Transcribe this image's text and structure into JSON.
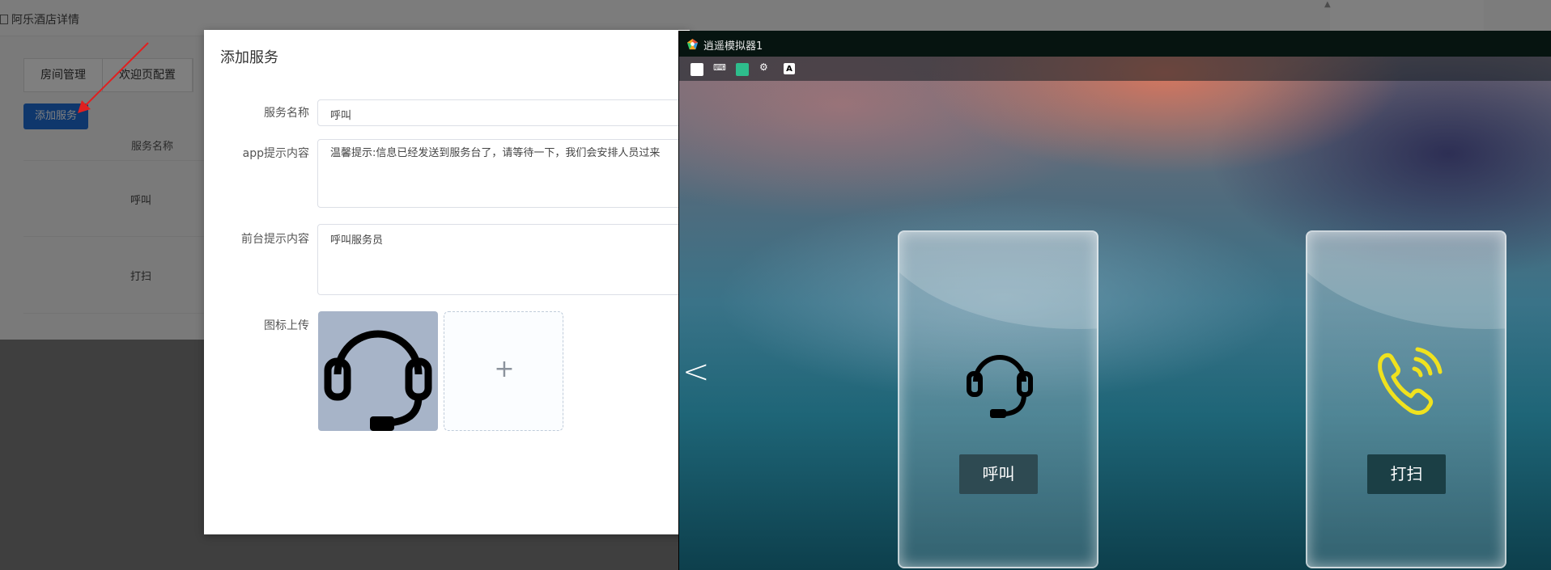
{
  "background_page": {
    "title": "阿乐酒店详情",
    "tabs": [
      "房间管理",
      "欢迎页配置"
    ],
    "add_button": "添加服务",
    "table": {
      "column_header": "服务名称",
      "rows": [
        "呼叫",
        "打扫"
      ]
    }
  },
  "modal": {
    "title": "添加服务",
    "fields": {
      "service_name": {
        "label": "服务名称",
        "value": "呼叫"
      },
      "app_tip": {
        "label": "app提示内容",
        "value": "温馨提示:信息已经发送到服务台了，请等待一下，我们会安排人员过来"
      },
      "front_tip": {
        "label": "前台提示内容",
        "value": "呼叫服务员"
      },
      "icon_upload": {
        "label": "图标上传",
        "plus": "+"
      }
    }
  },
  "emulator": {
    "title": "逍遥模拟器1",
    "toolbar_icons": [
      "home-icon",
      "keyboard-icon",
      "app-store-icon",
      "settings-icon",
      "text-icon"
    ],
    "toolbar_text_icon": "A",
    "back_glyph": "<",
    "cards": [
      {
        "label": "呼叫",
        "icon": "headset-icon"
      },
      {
        "label": "打扫",
        "icon": "phone-icon"
      }
    ],
    "colors": {
      "phone_icon": "#f0e21e",
      "card_label_bg": "#2e4a52"
    }
  },
  "colors": {
    "primary_button": "#1e6fd9"
  }
}
